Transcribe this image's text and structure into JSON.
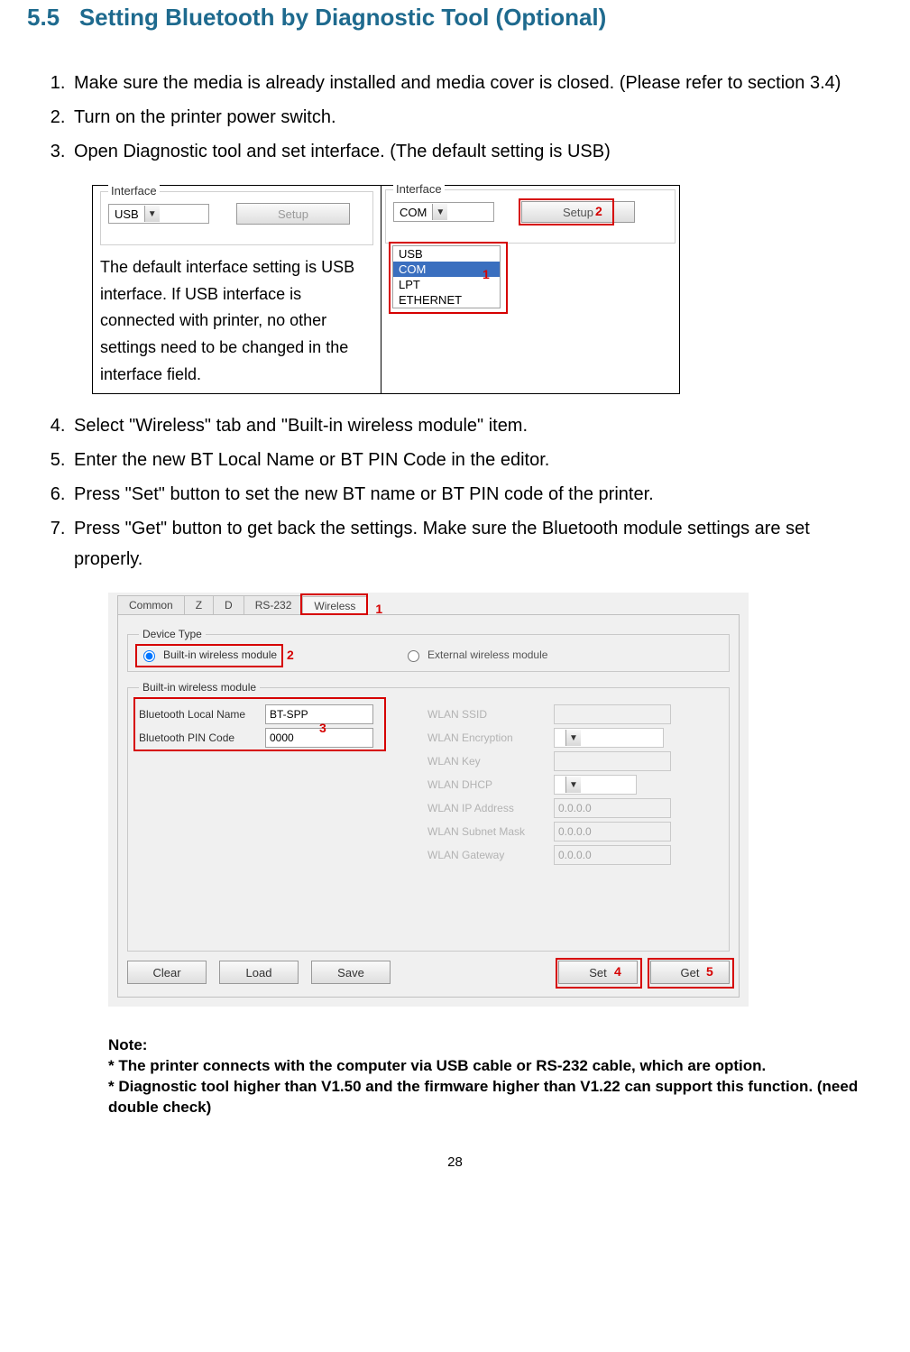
{
  "section": {
    "number": "5.5",
    "title": "Setting Bluetooth by Diagnostic Tool (Optional)"
  },
  "steps_part1": [
    "Make sure the media is already installed and media cover is closed. (Please refer to section 3.4)",
    "Turn on the printer power switch.",
    "Open Diagnostic tool and set interface. (The default setting is USB)"
  ],
  "usb_panel": {
    "group_label": "Interface",
    "combo_value": "USB",
    "setup_btn": "Setup",
    "description": "The default interface setting is USB interface. If USB interface is connected with printer, no other settings need to be changed in the interface field."
  },
  "com_panel": {
    "group_label": "Interface",
    "combo_value": "COM",
    "setup_btn": "Setup",
    "options": [
      "USB",
      "COM",
      "LPT",
      "ETHERNET"
    ],
    "callout_list": "1",
    "callout_setup": "2"
  },
  "steps_part2": [
    "Select \"Wireless\" tab and \"Built-in wireless module\" item.",
    "Enter the new BT Local Name or BT PIN Code in the editor.",
    "Press \"Set\" button to set the new BT name or BT PIN code of the printer.",
    "Press \"Get\" button to get back the settings. Make sure the Bluetooth module settings are set properly."
  ],
  "shot2": {
    "tabs": [
      "Common",
      "Z",
      "D",
      "RS-232",
      "Wireless"
    ],
    "device_type_legend": "Device Type",
    "radio_builtin": "Built-in wireless module",
    "radio_external": "External wireless module",
    "builtin_legend": "Built-in wireless module",
    "bt_local_label": "Bluetooth Local Name",
    "bt_local_value": "BT-SPP",
    "bt_pin_label": "Bluetooth PIN Code",
    "bt_pin_value": "0000",
    "wlan_ssid": "WLAN SSID",
    "wlan_enc": "WLAN Encryption",
    "wlan_key": "WLAN Key",
    "wlan_dhcp": "WLAN DHCP",
    "wlan_ip": "WLAN IP Address",
    "wlan_ip_val": "0.0.0.0",
    "wlan_mask": "WLAN Subnet Mask",
    "wlan_mask_val": "0.0.0.0",
    "wlan_gw": "WLAN Gateway",
    "wlan_gw_val": "0.0.0.0",
    "btn_clear": "Clear",
    "btn_load": "Load",
    "btn_save": "Save",
    "btn_set": "Set",
    "btn_get": "Get",
    "c_tab": "1",
    "c_radio": "2",
    "c_bt": "3",
    "c_set": "4",
    "c_get": "5"
  },
  "note": {
    "heading": "Note:",
    "l1": "* The printer connects with the computer via USB cable or RS-232 cable, which are option.",
    "l2": "* Diagnostic tool higher than V1.50 and the firmware higher than V1.22 can support this function. (need double check)"
  },
  "page_number": "28"
}
